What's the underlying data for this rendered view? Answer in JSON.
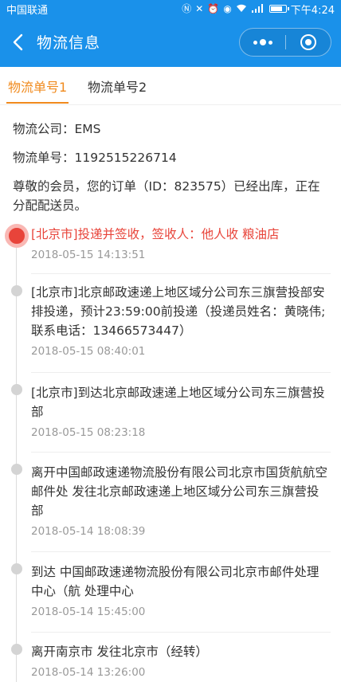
{
  "status_bar": {
    "carrier": "中国联通",
    "battery_level": 0.85,
    "time": "下午4:24",
    "icons": [
      "nfc-icon",
      "mute-icon",
      "alarm-icon",
      "eye-icon",
      "wifi-icon",
      "signal-4g-icon",
      "battery-icon"
    ]
  },
  "nav": {
    "title": "物流信息",
    "back_icon": "chevron-left-icon",
    "more_icon": "more-dots-icon",
    "close_icon": "target-icon"
  },
  "tabs": [
    {
      "label": "物流单号1",
      "active": true
    },
    {
      "label": "物流单号2",
      "active": false
    }
  ],
  "info": {
    "company": "物流公司：EMS",
    "tracking": "物流单号：1192515226714",
    "notice": "尊敬的会员，您的订单（ID：823575）已经出库，正在分配配送员。"
  },
  "events": [
    {
      "text": "[北京市]投递并签收，签收人：他人收 粮油店",
      "time": "2018-05-15 14:13:51",
      "active": true
    },
    {
      "text": "[北京市]北京邮政速递上地区域分公司东三旗营投部安排投递，预计23:59:00前投递（投递员姓名：黄晓伟;联系电话：13466573447）",
      "time": "2018-05-15 08:40:01",
      "active": false
    },
    {
      "text": "[北京市]到达北京邮政速递上地区域分公司东三旗营投部",
      "time": "2018-05-15 08:23:18",
      "active": false
    },
    {
      "text": "离开中国邮政速递物流股份有限公司北京市国货航航空邮件处 发往北京邮政速递上地区域分公司东三旗营投部",
      "time": "2018-05-14 18:08:39",
      "active": false
    },
    {
      "text": "到达 中国邮政速递物流股份有限公司北京市邮件处理中心（航 处理中心",
      "time": "2018-05-14 15:45:00",
      "active": false
    },
    {
      "text": "离开南京市 发往北京市（经转）",
      "time": "2018-05-14 13:26:00",
      "active": false
    }
  ],
  "colors": {
    "primary": "#1a91ea",
    "accent": "#f08a1d",
    "active_event": "#e8443a",
    "muted": "#999999"
  }
}
